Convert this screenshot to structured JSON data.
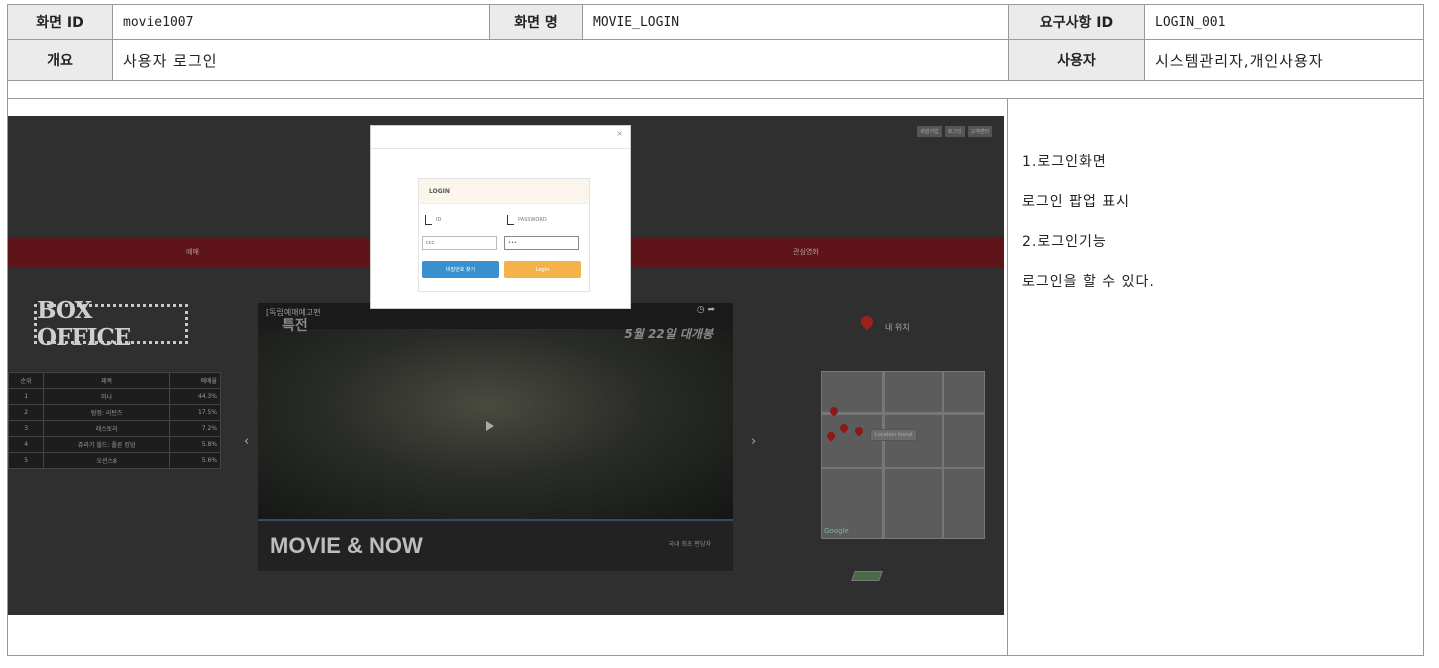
{
  "spec": {
    "screen_id_label": "화면 ID",
    "screen_id": "movie1007",
    "screen_name_label": "화면 명",
    "screen_name": "MOVIE_LOGIN",
    "req_id_label": "요구사항 ID",
    "req_id": "LOGIN_001",
    "overview_label": "개요",
    "overview": "사용자 로그인",
    "user_label": "사용자",
    "user": "시스템관리자,개인사용자"
  },
  "description": [
    "1.로그인화면",
    "로그인 팝업 표시",
    "2.로그인기능",
    "로그인을 할 수 있다."
  ],
  "site": {
    "top_links": [
      "회원가입",
      "로그인",
      "고객센터"
    ],
    "nav": [
      "예매",
      "관심영화"
    ],
    "box_office_title": "BOX OFFICE",
    "rank_headers": [
      "순위",
      "제목",
      "예매율"
    ],
    "rank_rows": [
      [
        "1",
        "미나",
        "44.3%"
      ],
      [
        "2",
        "탐정: 리턴즈",
        "17.5%"
      ],
      [
        "3",
        "레스토리",
        "7.2%"
      ],
      [
        "4",
        "쥬라기 월드: 폴른 킹덤",
        "5.8%"
      ],
      [
        "5",
        "오션스8",
        "5.6%"
      ]
    ],
    "video_title": "[독립예매예고편",
    "video_title2": "특전",
    "video_date": "5월 22일 대개봉",
    "video_brand": "MOVIE & NOW",
    "video_sub": "국내 최초 편당자",
    "my_location": "내 위치",
    "map_popup": "Location found",
    "map_google": "Google",
    "prev": "‹",
    "next": "›"
  },
  "login_modal": {
    "close": "×",
    "heading": "LOGIN",
    "id_label": "ID",
    "password_label": "PASSWORD",
    "id_value": "ccc",
    "password_value": "•••",
    "find_password": "비밀번호 찾기",
    "login": "Login"
  }
}
